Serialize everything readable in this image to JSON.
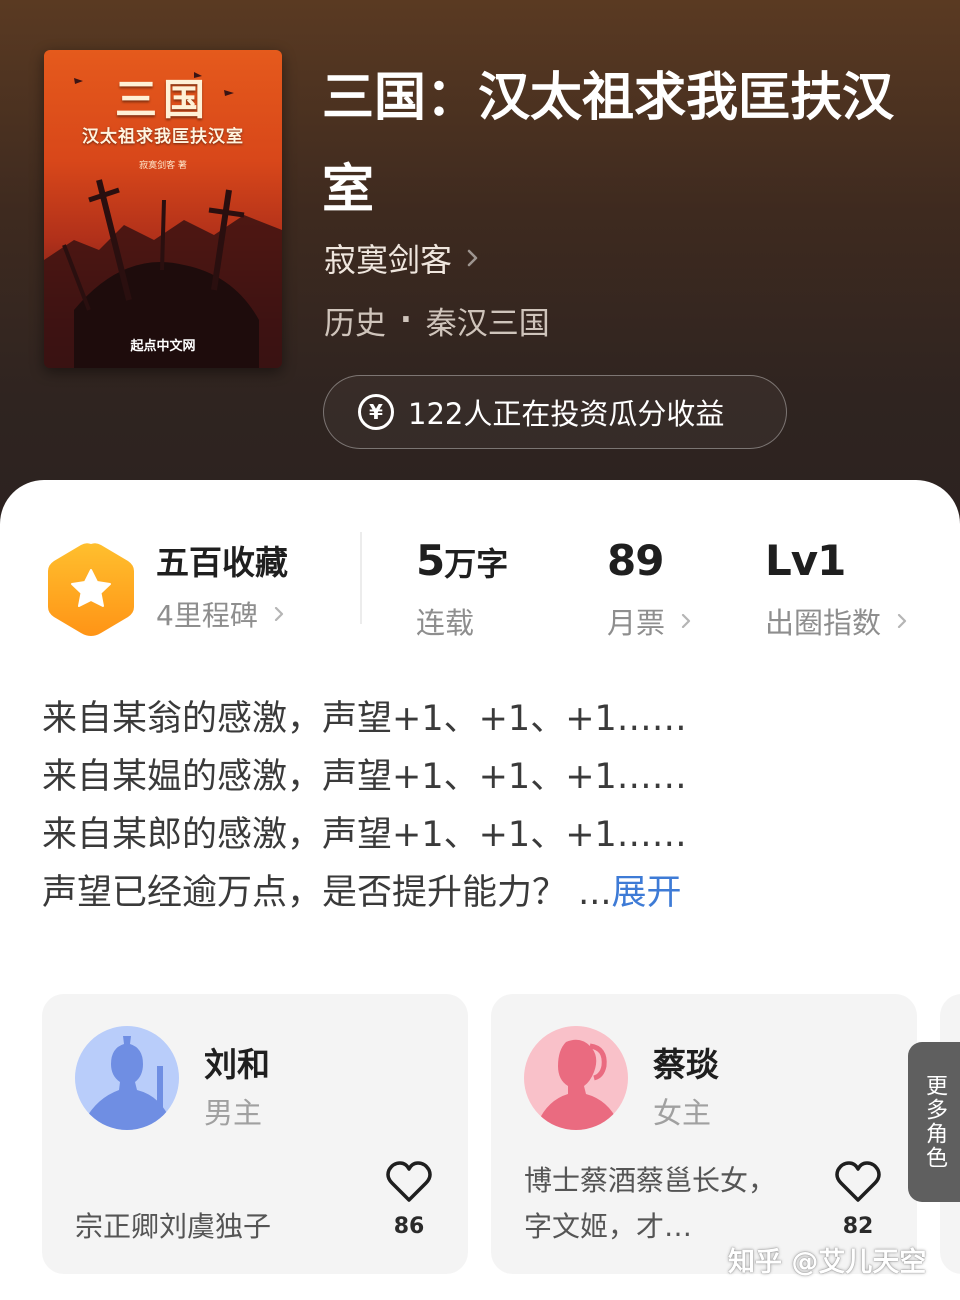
{
  "book": {
    "cover_title": "三国",
    "cover_subtitle": "汉太祖求我匡扶汉室",
    "cover_author": "寂寞剑客 著",
    "cover_publisher": "起点中文网",
    "title": "三国：汉太祖求我匡扶汉室",
    "author": "寂寞剑客",
    "genre_main": "历史",
    "genre_dot": "·",
    "genre_sub": "秦汉三国",
    "invest_icon": "¥",
    "invest_text": "122人正在投资瓜分收益"
  },
  "stats": {
    "milestone_title": "五百收藏",
    "milestone_sub": "4里程碑",
    "word_count_value": "5",
    "word_count_unit": "万字",
    "word_count_label": "连载",
    "monthly_votes_value": "89",
    "monthly_votes_label": "月票",
    "circle_index_value": "Lv1",
    "circle_index_label": "出圈指数"
  },
  "synopsis": {
    "lines": [
      "来自某翁的感激，声望+1、+1、+1……",
      "来自某媪的感激，声望+1、+1、+1……",
      "来自某郎的感激，声望+1、+1、+1……",
      "声望已经逾万点，是否提升能力？ ..."
    ],
    "expand_label": "展开"
  },
  "characters": [
    {
      "name": "刘和",
      "role": "男主",
      "desc": "宗正卿刘虞独子",
      "likes": "86",
      "avatar_color": "#7d9be8"
    },
    {
      "name": "蔡琰",
      "role": "女主",
      "desc": "博士蔡酒蔡邕长女，字文姬，才…",
      "likes": "82",
      "avatar_color": "#f07f8e"
    }
  ],
  "more_roles_label": "更多角色",
  "watermark": "知乎 @艾儿天空",
  "icons": {
    "badge": "star-hexagon-icon",
    "chevron": "chevron-right-icon",
    "like": "heart-outline-icon",
    "currency": "yen-circle-icon"
  },
  "colors": {
    "badge_orange": "#ffa81f",
    "expand_link": "#3e7bd6",
    "hero_bg": "#3e2a1f"
  }
}
